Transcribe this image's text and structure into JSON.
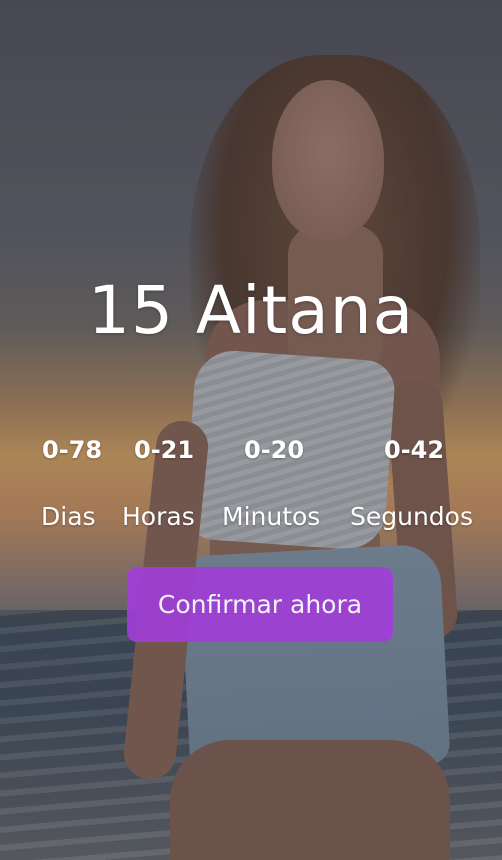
{
  "hero": {
    "title": "15 Aitana"
  },
  "countdown": {
    "units": [
      {
        "value": "0-78",
        "label": "Dias"
      },
      {
        "value": "0-21",
        "label": "Horas"
      },
      {
        "value": "0-20",
        "label": "Minutos"
      },
      {
        "value": "0-42",
        "label": "Segundos"
      }
    ]
  },
  "cta": {
    "label": "Confirmar ahora",
    "color": "#a03ed8"
  }
}
